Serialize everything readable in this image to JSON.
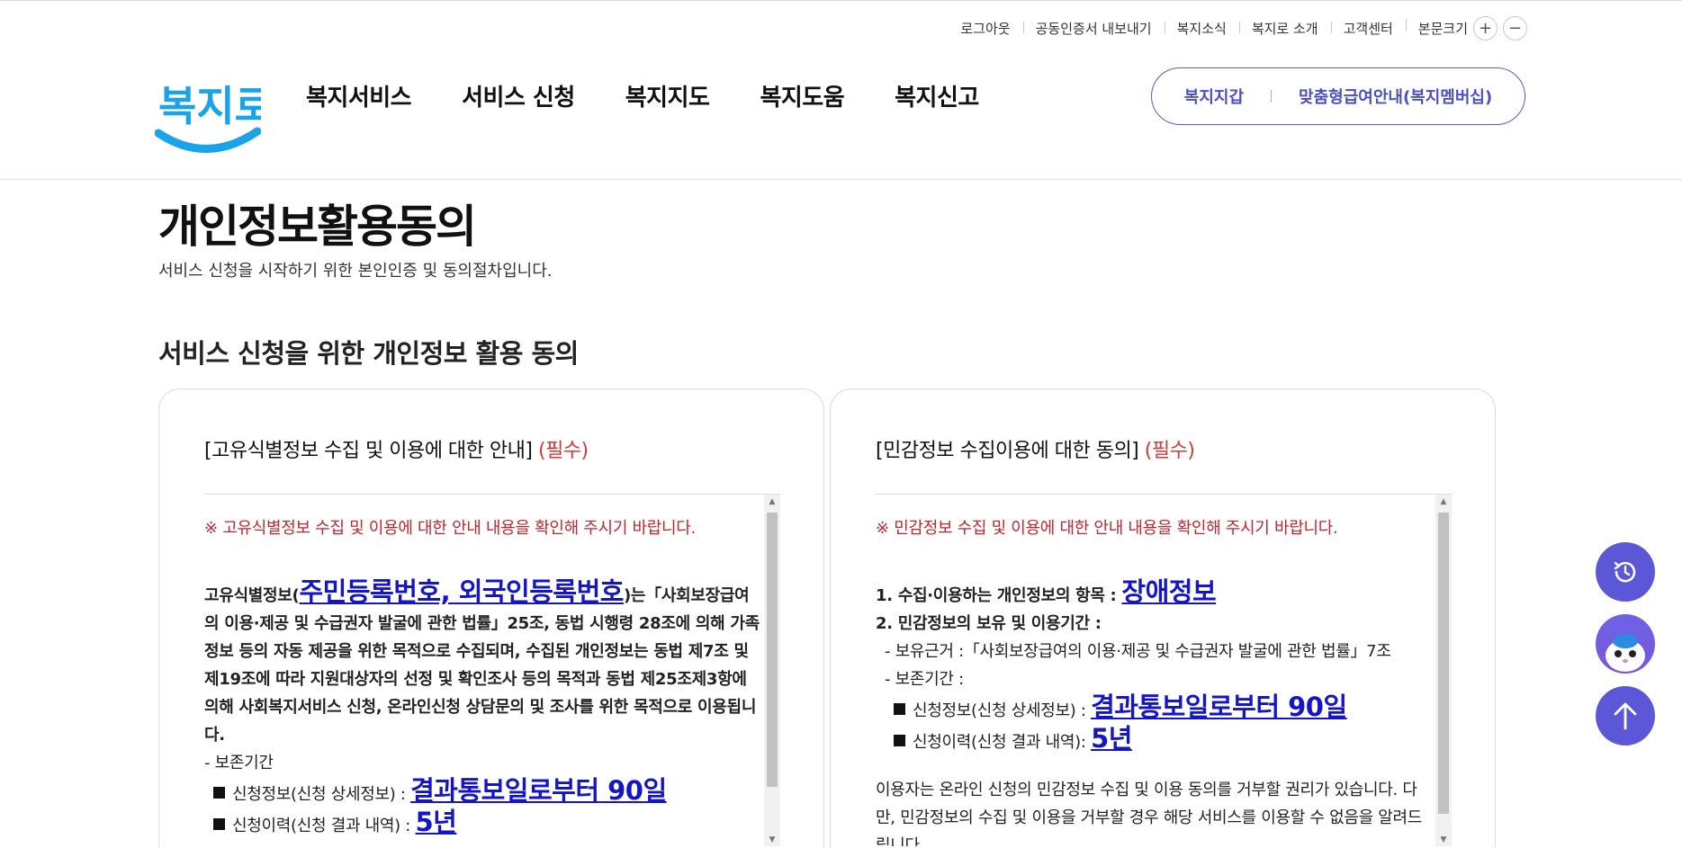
{
  "utility": {
    "items": [
      "로그아웃",
      "공동인증서 내보내기",
      "복지소식",
      "복지로 소개",
      "고객센터"
    ],
    "font_size_label": "본문크기",
    "zoom_in": "+",
    "zoom_out": "−"
  },
  "header": {
    "logo_text": "복지로",
    "nav": [
      "복지서비스",
      "서비스 신청",
      "복지지도",
      "복지도움",
      "복지신고"
    ],
    "pill_links": [
      "복지지갑",
      "맞춤형급여안내(복지멤버십)"
    ]
  },
  "page": {
    "title": "개인정보활용동의",
    "subtitle": "서비스 신청을 시작하기 위한 본인인증 및 동의절차입니다.",
    "section_title": "서비스 신청을 위한 개인정보 활용 동의"
  },
  "left_card": {
    "heading": "[고유식별정보 수집 및 이용에 대한 안내]",
    "required": "(필수)",
    "notice": "※ 고유식별정보 수집 및 이용에 대한 안내 내용을 확인해 주시기 바랍니다.",
    "para_prefix": "고유식별정보(",
    "para_link": "주민등록번호, 외국인등록번호",
    "para_rest": ")는「사회보장급여의 이용·제공 및 수급권자 발굴에 관한 법률」25조, 동법 시행령 28조에 의해 가족정보 등의 자동 제공을 위한 목적으로 수집되며, 수집된 개인정보는 동법 제7조 및 제19조에 따라 지원대상자의 선정 및 확인조사 등의 목적과 동법 제25조제3항에 의해 사회복지서비스 신청, 온라인신청 상담문의 및 조사를 위한 목적으로 이용됩니다.",
    "retention_label": "- 보존기간",
    "row1_label": "신청정보(신청 상세정보) : ",
    "row1_value": "결과통보일로부터 90일",
    "row2_label": "신청이력(신청 결과 내역) : ",
    "row2_value": "5년"
  },
  "right_card": {
    "heading": "[민감정보 수집이용에 대한 동의]",
    "required": "(필수)",
    "notice": "※ 민감정보 수집 및 이용에 대한 안내 내용을 확인해 주시기 바랍니다.",
    "item1_label": "1. 수집·이용하는 개인정보의 항목 : ",
    "item1_value": "장애정보",
    "item2_label": "2. 민감정보의 보유 및 이용기간 :",
    "basis": "- 보유근거 :「사회보장급여의 이용·제공 및 수급권자 발굴에 관한 법률」7조",
    "retention": "- 보존기간 :",
    "row1_label": "신청정보(신청 상세정보) : ",
    "row1_value": "결과통보일로부터 90일",
    "row2_label": "신청이력(신청 결과 내역): ",
    "row2_value": "5년",
    "footer_text": "이용자는 온라인 신청의 민감정보 수집 및 이용 동의를 거부할 권리가 있습니다. 다만, 민감정보의 수집 및 이용을 거부할 경우 해당 서비스를 이용할 수 없음을 알려드립니다."
  },
  "colors": {
    "accent": "#5b57d6",
    "required_red": "#d23b3b",
    "link_blue": "#1515c8",
    "logo_blue": "#1aa3e8"
  },
  "icons": {
    "history": "history-icon",
    "mascot": "mascot-icon",
    "top": "arrow-up-icon"
  }
}
